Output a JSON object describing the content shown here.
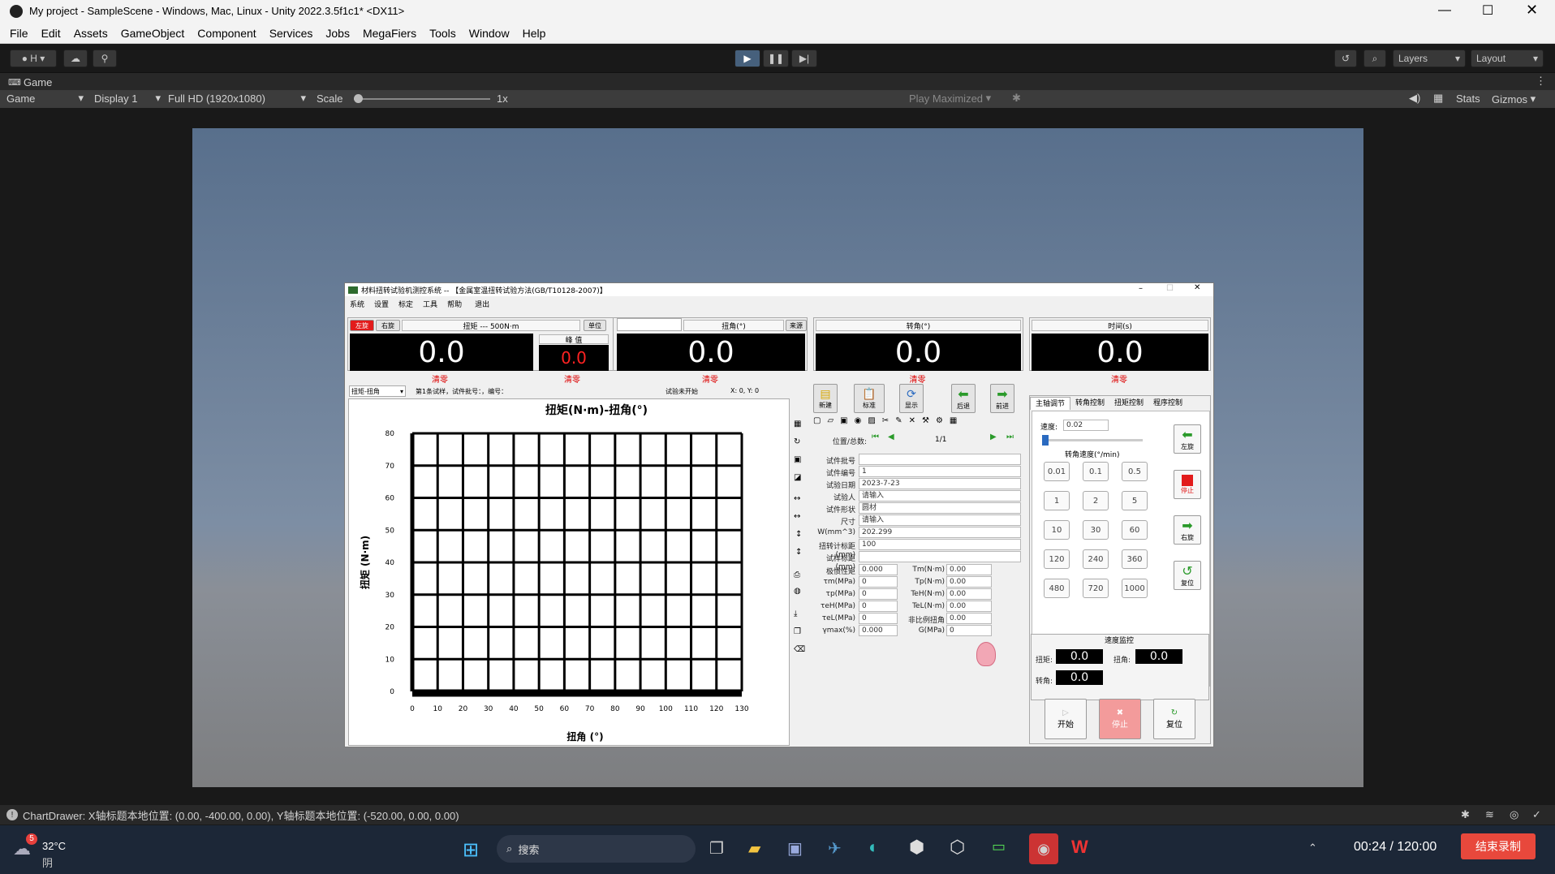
{
  "window": {
    "title": "My project - SampleScene - Windows, Mac, Linux - Unity 2022.3.5f1c1* <DX11>"
  },
  "menu": [
    "File",
    "Edit",
    "Assets",
    "GameObject",
    "Component",
    "Services",
    "Jobs",
    "MegaFiers",
    "Tools",
    "Window",
    "Help"
  ],
  "toolbar": {
    "account": "H",
    "layers": "Layers",
    "layout": "Layout"
  },
  "gametab": {
    "label": "Game"
  },
  "gamebar": {
    "mode": "Game",
    "display": "Display 1",
    "resolution": "Full HD (1920x1080)",
    "scale_label": "Scale",
    "scale_value": "1x",
    "play_maximized": "Play Maximized",
    "stats": "Stats",
    "gizmos": "Gizmos"
  },
  "console": {
    "message": "ChartDrawer: X轴标题本地位置: (0.00, -400.00, 0.00), Y轴标题本地位置: (-520.00, 0.00, 0.00)"
  },
  "app": {
    "title": "材料扭转试验机测控系统 -- 【金属室温扭转试验方法(GB/T10128-2007)】",
    "menu": [
      "系统",
      "设置",
      "标定",
      "工具",
      "帮助",
      "退出"
    ],
    "torque": {
      "left_btn": "左旋",
      "right_btn": "右旋",
      "header": "扭矩 --- 500N·m",
      "unit_btn": "单位",
      "value": "0.0",
      "clear": "清零",
      "peak_label": "峰 值",
      "peak_value": "0.0",
      "peak_clear": "清零"
    },
    "angle": {
      "header": "扭角(°)",
      "src_btn": "来源",
      "value": "0.0",
      "clear": "清零"
    },
    "rotation": {
      "header": "转角(°)",
      "value": "0.0",
      "clear": "清零"
    },
    "time": {
      "header": "时间(s)",
      "value": "0.0",
      "clear": "清零"
    },
    "chartbar": {
      "select": "扭矩-扭角",
      "info": "第1条试样，试件批号：，编号：",
      "status": "试验未开始",
      "coords": "X: 0, Y: 0"
    },
    "form": {
      "toolbar": [
        "新建",
        "标准",
        "显示",
        "后退",
        "前进"
      ],
      "position_label": "位置/总数:",
      "position_value": "1/1",
      "fields": [
        {
          "label": "试件批号",
          "value": ""
        },
        {
          "label": "试件编号",
          "value": "1"
        },
        {
          "label": "试验日期",
          "value": "2023-7-23"
        },
        {
          "label": "试验人",
          "value": "请输入"
        },
        {
          "label": "试件形状",
          "value": "圆材"
        },
        {
          "label": "尺寸",
          "value": "请输入"
        },
        {
          "label": "W(mm^3)",
          "value": "202.299"
        },
        {
          "label": "扭转计标距(mm)",
          "value": "100"
        },
        {
          "label": "试样标距(mm)",
          "value": ""
        }
      ],
      "results_left": [
        {
          "label": "极惯性矩",
          "value": "0.000"
        },
        {
          "label": "τm(MPa)",
          "value": "0"
        },
        {
          "label": "τp(MPa)",
          "value": "0"
        },
        {
          "label": "τeH(MPa)",
          "value": "0"
        },
        {
          "label": "τeL(MPa)",
          "value": "0"
        },
        {
          "label": "γmax(%)",
          "value": "0.000"
        }
      ],
      "results_right": [
        {
          "label": "Tm(N·m)",
          "value": "0.00"
        },
        {
          "label": "Tp(N·m)",
          "value": "0.00"
        },
        {
          "label": "TeH(N·m)",
          "value": "0.00"
        },
        {
          "label": "TeL(N·m)",
          "value": "0.00"
        },
        {
          "label": "非比例扭角",
          "value": "0.00"
        },
        {
          "label": "G(MPa)",
          "value": "0"
        }
      ]
    },
    "control": {
      "tabs": [
        "主轴调节",
        "转角控制",
        "扭矩控制",
        "程序控制"
      ],
      "speed_label": "速度:",
      "speed_value": "0.02",
      "speed_title": "转角速度(°/min)",
      "speeds": [
        "0.01",
        "0.1",
        "0.5",
        "1",
        "2",
        "5",
        "10",
        "30",
        "60",
        "120",
        "240",
        "360",
        "480",
        "720",
        "1000"
      ],
      "side_buttons": [
        "左旋",
        "停止",
        "右旋",
        "复位"
      ],
      "monitor_title": "速度监控",
      "monitor": [
        {
          "label": "扭矩:",
          "value": "0.0"
        },
        {
          "label": "扭角:",
          "value": "0.0"
        },
        {
          "label": "转角:",
          "value": "0.0"
        }
      ],
      "bottom_buttons": [
        "开始",
        "停止",
        "复位"
      ]
    },
    "chart_data": {
      "type": "line",
      "title": "扭矩(N·m)-扭角(°)",
      "xlabel": "扭角 (°)",
      "ylabel": "扭矩 (N·m)",
      "xlim": [
        0,
        130
      ],
      "ylim": [
        0,
        80
      ],
      "xticks": [
        "0",
        "10",
        "20",
        "30",
        "40",
        "50",
        "60",
        "70",
        "80",
        "90",
        "100",
        "110",
        "120",
        "130"
      ],
      "yticks": [
        "0",
        "10",
        "20",
        "30",
        "40",
        "50",
        "60",
        "70",
        "80"
      ],
      "grid": true,
      "series": []
    }
  },
  "taskbar": {
    "weather_temp": "32°C",
    "weather_desc": "阴",
    "weather_badge": "5",
    "search": "搜索",
    "timer": "00:24 / 120:00",
    "end_record": "结束录制"
  }
}
